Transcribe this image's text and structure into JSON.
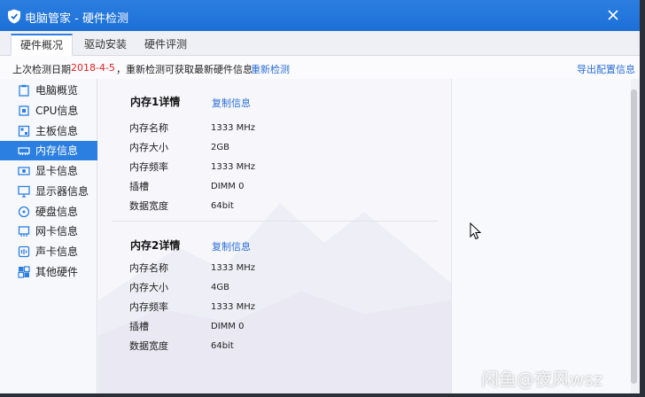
{
  "window": {
    "title": "电脑管家 - 硬件检测",
    "accent": "#2b7fe0"
  },
  "tabs": [
    {
      "label": "硬件概况",
      "active": true
    },
    {
      "label": "驱动安装",
      "active": false
    },
    {
      "label": "硬件评测",
      "active": false
    }
  ],
  "infobar": {
    "prefix": "上次检测日期",
    "date": "2018-4-5",
    "message": "，重新检测可获取最新硬件信息",
    "recheck": "重新检测",
    "export": "导出配置信息"
  },
  "sidebar": {
    "items": [
      {
        "label": "电脑概览",
        "icon": "clipboard-icon"
      },
      {
        "label": "CPU信息",
        "icon": "cpu-icon"
      },
      {
        "label": "主板信息",
        "icon": "motherboard-icon"
      },
      {
        "label": "内存信息",
        "icon": "memory-icon",
        "active": true
      },
      {
        "label": "显卡信息",
        "icon": "gpu-icon"
      },
      {
        "label": "显示器信息",
        "icon": "monitor-icon"
      },
      {
        "label": "硬盘信息",
        "icon": "disk-icon"
      },
      {
        "label": "网卡信息",
        "icon": "network-card-icon"
      },
      {
        "label": "声卡信息",
        "icon": "sound-card-icon"
      },
      {
        "label": "其他硬件",
        "icon": "other-hardware-icon"
      }
    ]
  },
  "memory": [
    {
      "title": "内存1详情",
      "copy": "复制信息",
      "rows": [
        {
          "label": "内存名称",
          "value": "1333 MHz"
        },
        {
          "label": "内存大小",
          "value": "2GB"
        },
        {
          "label": "内存频率",
          "value": "1333 MHz"
        },
        {
          "label": "插槽",
          "value": "DIMM 0"
        },
        {
          "label": "数据宽度",
          "value": "64bit"
        }
      ]
    },
    {
      "title": "内存2详情",
      "copy": "复制信息",
      "rows": [
        {
          "label": "内存名称",
          "value": "1333 MHz"
        },
        {
          "label": "内存大小",
          "value": "4GB"
        },
        {
          "label": "内存频率",
          "value": "1333 MHz"
        },
        {
          "label": "插槽",
          "value": "DIMM 0"
        },
        {
          "label": "数据宽度",
          "value": "64bit"
        }
      ]
    }
  ],
  "watermark": "闲鱼@夜风wsz"
}
